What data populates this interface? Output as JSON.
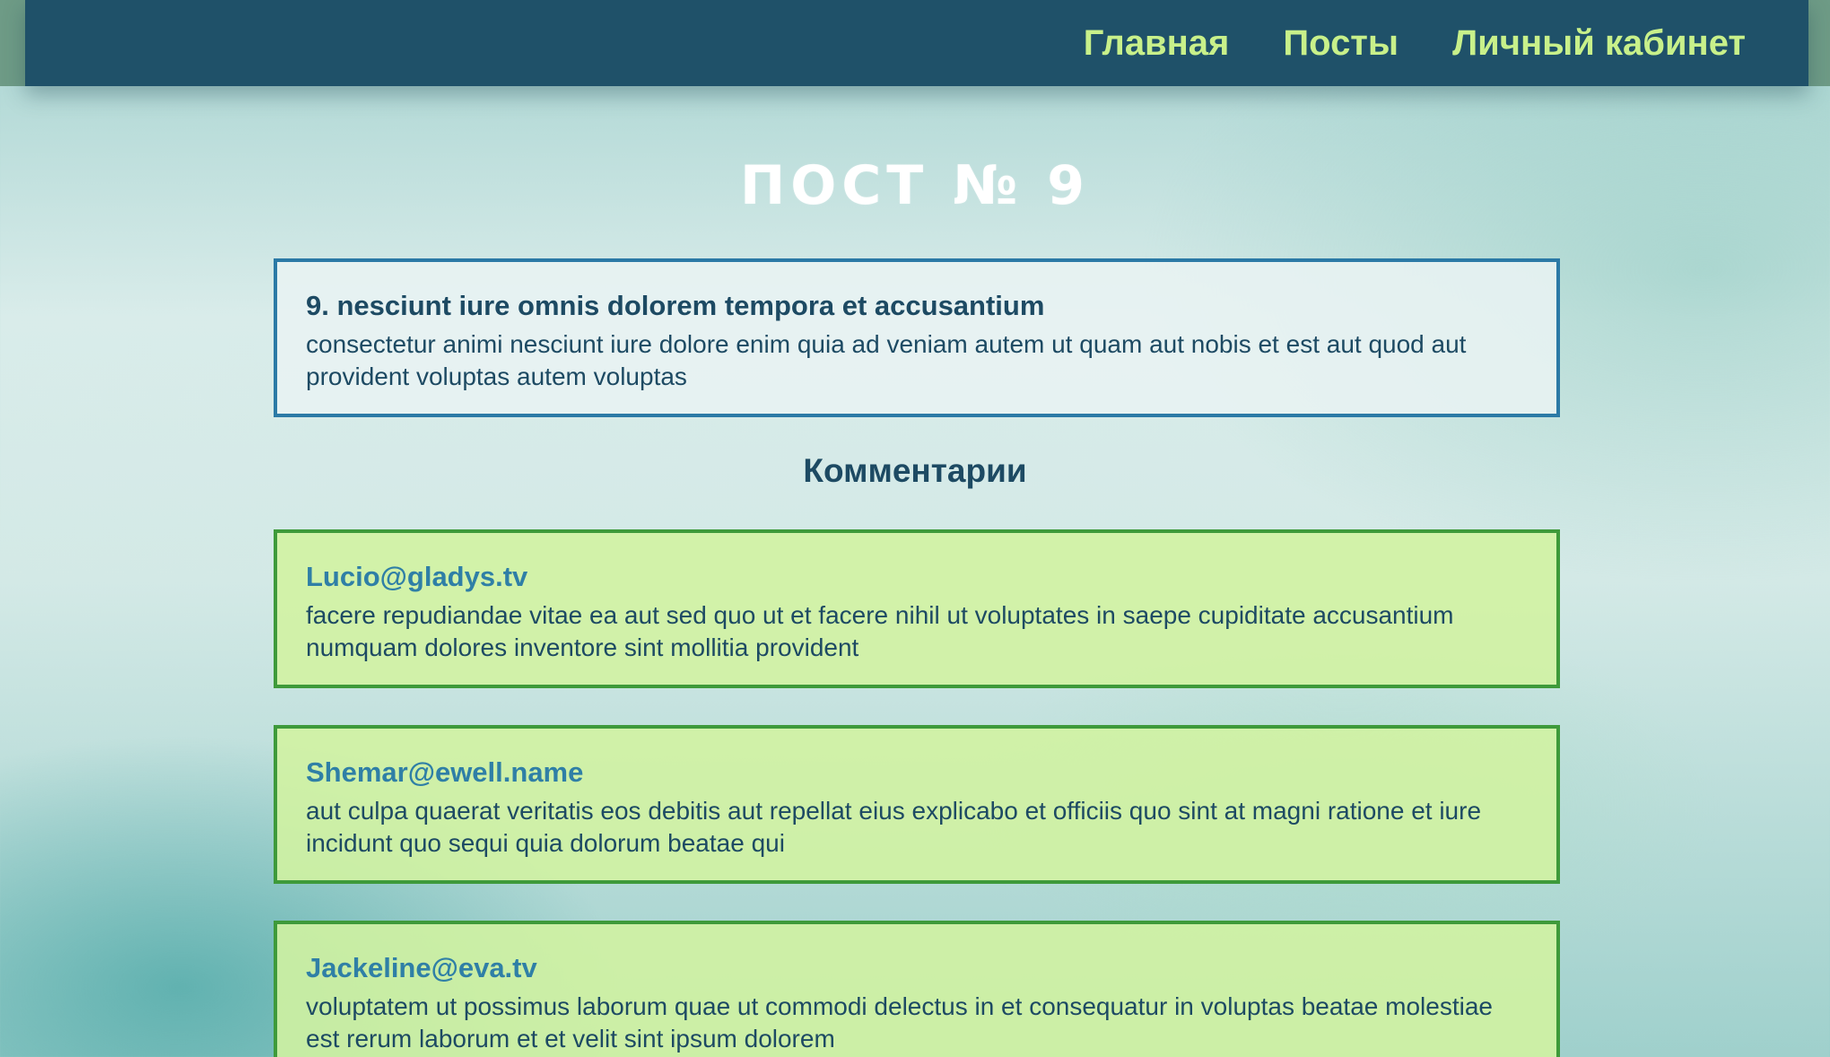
{
  "nav": {
    "items": [
      {
        "label": "Главная"
      },
      {
        "label": "Посты"
      },
      {
        "label": "Личный кабинет"
      }
    ]
  },
  "page": {
    "title": "ПОСТ № 9"
  },
  "post": {
    "title": "9. nesciunt iure omnis dolorem tempora et accusantium",
    "body": "consectetur animi nesciunt iure dolore enim quia ad veniam autem ut quam aut nobis et est aut quod aut provident voluptas autem voluptas"
  },
  "comments": {
    "heading": "Комментарии",
    "items": [
      {
        "email": "Lucio@gladys.tv",
        "body": "facere repudiandae vitae ea aut sed quo ut et facere nihil ut voluptates in saepe cupiditate accusantium numquam dolores inventore sint mollitia provident"
      },
      {
        "email": "Shemar@ewell.name",
        "body": "aut culpa quaerat veritatis eos debitis aut repellat eius explicabo et officiis quo sint at magni ratione et iure incidunt quo sequi quia dolorum beatae qui"
      },
      {
        "email": "Jackeline@eva.tv",
        "body": "voluptatem ut possimus laborum quae ut commodi delectus in et consequatur in voluptas beatae molestiae est rerum laborum et et velit sint ipsum dolorem"
      }
    ]
  },
  "colors": {
    "navbar_bg": "#1f5169",
    "nav_link": "#c8f08a",
    "post_border": "#2b7aa6",
    "comment_border": "#3e9a3a",
    "comment_bg": "#d1f3a0",
    "text_dark": "#1d4a63",
    "email_text": "#2f7fa6"
  }
}
